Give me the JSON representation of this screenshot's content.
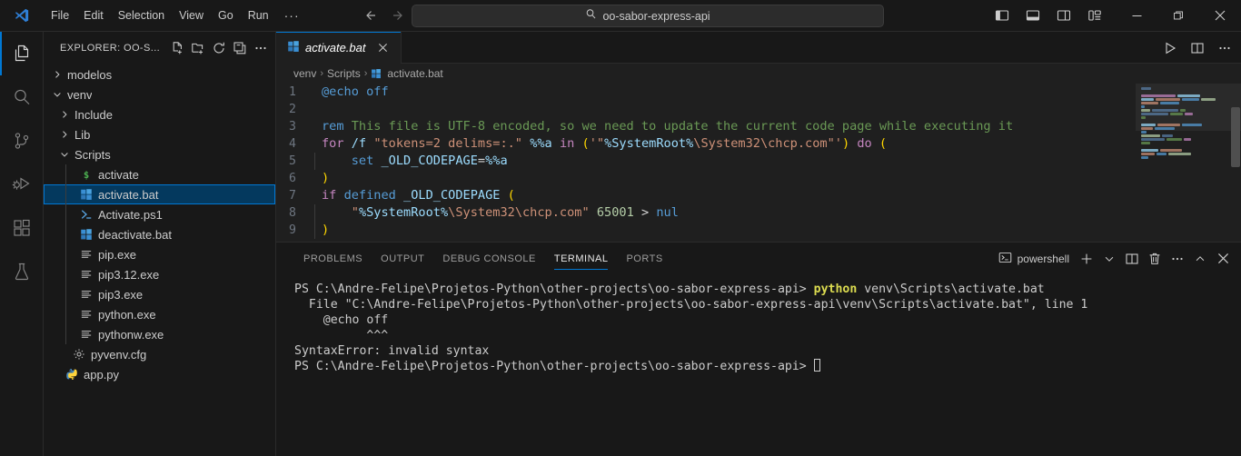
{
  "titlebar": {
    "logo_icon": "vscode-logo-icon",
    "menus": [
      "File",
      "Edit",
      "Selection",
      "View",
      "Go",
      "Run"
    ],
    "overflow_label": "···",
    "back_icon": "arrow-left-icon",
    "forward_icon": "arrow-right-icon",
    "search": {
      "icon": "search-icon",
      "value": "oo-sabor-express-api",
      "placeholder": "Search"
    },
    "layout_buttons": [
      {
        "name": "toggle-primary-sidebar-button",
        "icon": "layout-sidebar-left-icon"
      },
      {
        "name": "toggle-panel-button",
        "icon": "layout-panel-icon"
      },
      {
        "name": "toggle-secondary-sidebar-button",
        "icon": "layout-sidebar-right-icon"
      },
      {
        "name": "customize-layout-button",
        "icon": "layout-customize-icon"
      }
    ],
    "window_controls": [
      {
        "name": "minimize-button",
        "icon": "minimize-icon",
        "label": "—"
      },
      {
        "name": "maximize-button",
        "icon": "restore-icon",
        "label": "❐"
      },
      {
        "name": "close-button",
        "icon": "close-icon",
        "label": "✕"
      }
    ]
  },
  "activitybar": {
    "items": [
      {
        "name": "activity-explorer",
        "icon": "files-icon",
        "active": true
      },
      {
        "name": "activity-search",
        "icon": "search-icon",
        "active": false
      },
      {
        "name": "activity-source-control",
        "icon": "source-control-icon",
        "active": false
      },
      {
        "name": "activity-run-debug",
        "icon": "run-and-debug-icon",
        "active": false
      },
      {
        "name": "activity-extensions",
        "icon": "extensions-icon",
        "active": false
      },
      {
        "name": "activity-testing",
        "icon": "beaker-icon",
        "active": false
      }
    ]
  },
  "sidebar": {
    "title": "EXPLORER: OO-S...",
    "actions": [
      {
        "name": "new-file-button",
        "icon": "new-file-icon"
      },
      {
        "name": "new-folder-button",
        "icon": "new-folder-icon"
      },
      {
        "name": "refresh-explorer-button",
        "icon": "refresh-icon"
      },
      {
        "name": "collapse-folders-button",
        "icon": "collapse-all-icon"
      },
      {
        "name": "explorer-more-actions-button",
        "icon": "ellipsis-icon"
      }
    ],
    "tree": [
      {
        "label": "modelos",
        "indent": 0,
        "type": "folder",
        "expanded": false,
        "icon": "chevron-right-icon",
        "selected": false
      },
      {
        "label": "venv",
        "indent": 0,
        "type": "folder",
        "expanded": true,
        "icon": "chevron-down-icon",
        "selected": false
      },
      {
        "label": "Include",
        "indent": 1,
        "type": "folder",
        "expanded": false,
        "icon": "chevron-right-icon",
        "selected": false
      },
      {
        "label": "Lib",
        "indent": 1,
        "type": "folder",
        "expanded": false,
        "icon": "chevron-right-icon",
        "selected": false
      },
      {
        "label": "Scripts",
        "indent": 1,
        "type": "folder",
        "expanded": true,
        "icon": "chevron-down-icon",
        "selected": false
      },
      {
        "label": "activate",
        "indent": 2,
        "type": "file",
        "icon": "shell-dollar-icon",
        "selected": false
      },
      {
        "label": "activate.bat",
        "indent": 2,
        "type": "file",
        "icon": "windows-bat-icon",
        "selected": true
      },
      {
        "label": "Activate.ps1",
        "indent": 2,
        "type": "file",
        "icon": "powershell-icon",
        "selected": false
      },
      {
        "label": "deactivate.bat",
        "indent": 2,
        "type": "file",
        "icon": "windows-bat-icon",
        "selected": false
      },
      {
        "label": "pip.exe",
        "indent": 2,
        "type": "file",
        "icon": "binary-exe-icon",
        "selected": false
      },
      {
        "label": "pip3.12.exe",
        "indent": 2,
        "type": "file",
        "icon": "binary-exe-icon",
        "selected": false
      },
      {
        "label": "pip3.exe",
        "indent": 2,
        "type": "file",
        "icon": "binary-exe-icon",
        "selected": false
      },
      {
        "label": "python.exe",
        "indent": 2,
        "type": "file",
        "icon": "binary-exe-icon",
        "selected": false
      },
      {
        "label": "pythonw.exe",
        "indent": 2,
        "type": "file",
        "icon": "binary-exe-icon",
        "selected": false
      },
      {
        "label": "pyvenv.cfg",
        "indent": 1,
        "type": "file",
        "icon": "gear-config-icon",
        "selected": false
      },
      {
        "label": "app.py",
        "indent": 0,
        "type": "file",
        "icon": "python-icon",
        "selected": false
      }
    ]
  },
  "editor": {
    "tab": {
      "label": "activate.bat",
      "icon": "windows-bat-icon",
      "close_icon": "close-icon",
      "dirty": false
    },
    "actions": [
      {
        "name": "run-code-button",
        "icon": "play-icon"
      },
      {
        "name": "split-editor-button",
        "icon": "split-editor-icon"
      },
      {
        "name": "editor-more-actions-button",
        "icon": "ellipsis-icon"
      }
    ],
    "breadcrumb": [
      "venv",
      "Scripts",
      "activate.bat"
    ],
    "breadcrumb_file_icon": "windows-bat-icon",
    "lines": [
      {
        "n": "1",
        "tokens": [
          {
            "t": "@echo off",
            "c": "t-blue"
          }
        ]
      },
      {
        "n": "2",
        "tokens": []
      },
      {
        "n": "3",
        "tokens": [
          {
            "t": "rem",
            "c": "t-blue"
          },
          {
            "t": " This file is UTF-8 encoded, so we need to update the current code page while executing it",
            "c": "t-cmt"
          }
        ]
      },
      {
        "n": "4",
        "tokens": [
          {
            "t": "for",
            "c": "t-kw"
          },
          {
            "t": " ",
            "c": "t-plain"
          },
          {
            "t": "/f",
            "c": "t-var"
          },
          {
            "t": " ",
            "c": "t-plain"
          },
          {
            "t": "\"tokens=2 delims=:.\"",
            "c": "t-str"
          },
          {
            "t": " ",
            "c": "t-plain"
          },
          {
            "t": "%%a",
            "c": "t-var"
          },
          {
            "t": " ",
            "c": "t-plain"
          },
          {
            "t": "in",
            "c": "t-kw"
          },
          {
            "t": " ",
            "c": "t-plain"
          },
          {
            "t": "(",
            "c": "t-paren"
          },
          {
            "t": "'\"",
            "c": "t-str"
          },
          {
            "t": "%SystemRoot%",
            "c": "t-var"
          },
          {
            "t": "\\System32\\chcp.com",
            "c": "t-str"
          },
          {
            "t": "\"'",
            "c": "t-str"
          },
          {
            "t": ")",
            "c": "t-paren"
          },
          {
            "t": " ",
            "c": "t-plain"
          },
          {
            "t": "do",
            "c": "t-kw"
          },
          {
            "t": " ",
            "c": "t-plain"
          },
          {
            "t": "(",
            "c": "t-paren"
          }
        ]
      },
      {
        "n": "5",
        "indent": true,
        "tokens": [
          {
            "t": "    ",
            "c": "t-plain"
          },
          {
            "t": "set",
            "c": "t-blue"
          },
          {
            "t": " ",
            "c": "t-plain"
          },
          {
            "t": "_OLD_CODEPAGE",
            "c": "t-var"
          },
          {
            "t": "=",
            "c": "t-op"
          },
          {
            "t": "%%a",
            "c": "t-var"
          }
        ]
      },
      {
        "n": "6",
        "tokens": [
          {
            "t": ")",
            "c": "t-paren"
          }
        ]
      },
      {
        "n": "7",
        "tokens": [
          {
            "t": "if",
            "c": "t-kw"
          },
          {
            "t": " ",
            "c": "t-plain"
          },
          {
            "t": "defined",
            "c": "t-blue"
          },
          {
            "t": " ",
            "c": "t-plain"
          },
          {
            "t": "_OLD_CODEPAGE",
            "c": "t-var"
          },
          {
            "t": " ",
            "c": "t-plain"
          },
          {
            "t": "(",
            "c": "t-paren"
          }
        ]
      },
      {
        "n": "8",
        "indent": true,
        "tokens": [
          {
            "t": "    ",
            "c": "t-plain"
          },
          {
            "t": "\"",
            "c": "t-str"
          },
          {
            "t": "%SystemRoot%",
            "c": "t-var"
          },
          {
            "t": "\\System32\\chcp.com",
            "c": "t-str"
          },
          {
            "t": "\"",
            "c": "t-str"
          },
          {
            "t": " ",
            "c": "t-plain"
          },
          {
            "t": "65001",
            "c": "t-num"
          },
          {
            "t": " ",
            "c": "t-plain"
          },
          {
            "t": ">",
            "c": "t-op"
          },
          {
            "t": " ",
            "c": "t-plain"
          },
          {
            "t": "nul",
            "c": "t-blue"
          }
        ]
      },
      {
        "n": "9",
        "indent": true,
        "tokens": [
          {
            "t": ")",
            "c": "t-paren"
          }
        ]
      }
    ]
  },
  "panel": {
    "tabs": [
      {
        "label": "PROBLEMS",
        "active": false
      },
      {
        "label": "OUTPUT",
        "active": false
      },
      {
        "label": "DEBUG CONSOLE",
        "active": false
      },
      {
        "label": "TERMINAL",
        "active": true
      },
      {
        "label": "PORTS",
        "active": false
      }
    ],
    "terminal_chip": {
      "label": "powershell",
      "icon": "terminal-icon"
    },
    "actions": [
      {
        "name": "new-terminal-button",
        "icon": "plus-icon"
      },
      {
        "name": "terminal-profile-dropdown",
        "icon": "chevron-down-icon"
      },
      {
        "name": "split-terminal-button",
        "icon": "split-terminal-icon"
      },
      {
        "name": "kill-terminal-button",
        "icon": "trash-icon"
      },
      {
        "name": "panel-more-actions-button",
        "icon": "ellipsis-icon"
      },
      {
        "name": "maximize-panel-button",
        "icon": "chevron-up-icon"
      },
      {
        "name": "close-panel-button",
        "icon": "close-icon"
      }
    ],
    "terminal_lines": [
      {
        "segments": [
          {
            "t": "PS C:\\Andre-Felipe\\Projetos-Python\\other-projects\\oo-sabor-express-api> ",
            "c": ""
          },
          {
            "t": "python",
            "c": "hl-yellow"
          },
          {
            "t": " venv\\Scripts\\activate.bat",
            "c": ""
          }
        ]
      },
      {
        "segments": [
          {
            "t": "  File \"C:\\Andre-Felipe\\Projetos-Python\\other-projects\\oo-sabor-express-api\\venv\\Scripts\\activate.bat\", line 1",
            "c": ""
          }
        ]
      },
      {
        "segments": [
          {
            "t": "    @echo off",
            "c": ""
          }
        ]
      },
      {
        "segments": [
          {
            "t": "          ^^^",
            "c": ""
          }
        ]
      },
      {
        "segments": [
          {
            "t": "SyntaxError: invalid syntax",
            "c": ""
          }
        ]
      },
      {
        "segments": [
          {
            "t": "PS C:\\Andre-Felipe\\Projetos-Python\\other-projects\\oo-sabor-express-api> ",
            "c": ""
          }
        ],
        "cursor": true
      }
    ]
  },
  "colors": {
    "accent": "#0078d4",
    "titlebar_bg": "#181818",
    "editor_bg": "#1f1f1f",
    "selection_bg": "#04395e",
    "terminal_yellow": "#dcdc50"
  }
}
